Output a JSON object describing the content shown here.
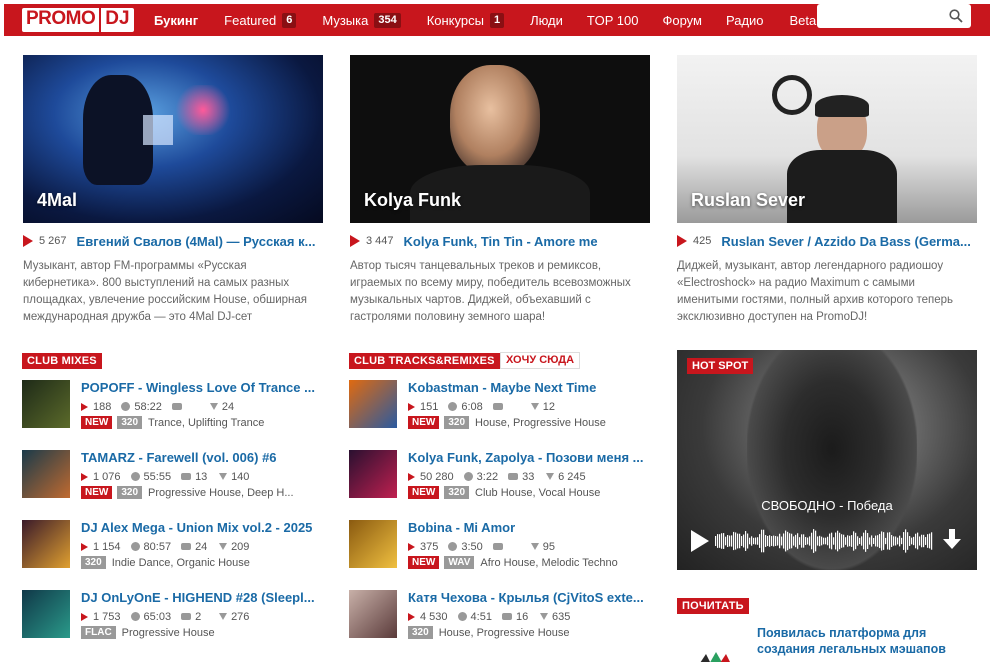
{
  "header": {
    "logo_left": "PROMO",
    "logo_right": "DJ",
    "nav": [
      {
        "label": "Букинг",
        "badge": null,
        "bold": true
      },
      {
        "label": "Featured",
        "badge": "6",
        "bold": false
      },
      {
        "label": "Музыка",
        "badge": "354",
        "bold": false
      },
      {
        "label": "Конкурсы",
        "badge": "1",
        "bold": false
      },
      {
        "label": "Люди",
        "badge": null,
        "bold": false
      },
      {
        "label": "TOP 100",
        "badge": null,
        "bold": false
      },
      {
        "label": "Форум",
        "badge": null,
        "bold": false
      },
      {
        "label": "Радио",
        "badge": null,
        "bold": false
      },
      {
        "label": "Beta",
        "badge": null,
        "bold": false
      }
    ],
    "search_placeholder": ""
  },
  "features": [
    {
      "name": "4Mal",
      "plays": "5 267",
      "title": "Евгений Свалов (4Mal) — Русская к...",
      "desc": "Музыкант, автор FM-программы «Русская кибернетика». 800 выступлений на самых разных площадках, увлечение российским House, обширная международная дружба — это 4Mal DJ-сет"
    },
    {
      "name": "Kolya Funk",
      "plays": "3 447",
      "title": "Kolya Funk, Tin Tin - Amore me",
      "desc": "Автор тысяч танцевальных треков и ремиксов, играемых по всему миру, победитель всевозможных музыкальных чартов. Диджей, объехавший с гастролями половину земного шара!"
    },
    {
      "name": "Ruslan Sever",
      "plays": "425",
      "title": "Ruslan Sever / Azzido Da Bass (Germa...",
      "desc": "Диджей, музыкант, автор легендарного радиошоу «Electroshock» на радио Maximum с самыми именитыми гостями, полный архив которого теперь эксклюзивно доступен на PromoDJ!"
    }
  ],
  "sections": {
    "club_mixes": "CLUB MIXES",
    "club_tracks": "CLUB TRACKS&REMIXES",
    "want_here": "ХОЧУ СЮДА",
    "hot_spot": "HOT SPOT",
    "read": "ПОЧИТАТЬ"
  },
  "mixes": [
    {
      "title": "POPOFF - Wingless Love Of Trance ...",
      "plays": "188",
      "duration": "58:22",
      "comments": "",
      "downloads": "24",
      "new": "NEW",
      "format": "320",
      "genre": "Trance, Uplifting Trance",
      "cover": [
        "#1e2a18",
        "#5b6a2a"
      ]
    },
    {
      "title": "TAMARZ - Farewell (vol. 006) #6",
      "plays": "1 076",
      "duration": "55:55",
      "comments": "13",
      "downloads": "140",
      "new": "NEW",
      "format": "320",
      "genre": "Progressive House, Deep H...",
      "cover": [
        "#1a3a4a",
        "#c06a30"
      ]
    },
    {
      "title": "DJ Alex Mega - Union Mix vol.2 - 2025",
      "plays": "1 154",
      "duration": "80:57",
      "comments": "24",
      "downloads": "209",
      "new": "",
      "format": "320",
      "genre": "Indie Dance, Organic House",
      "cover": [
        "#3a1a2a",
        "#e0a030"
      ]
    },
    {
      "title": "DJ OnLyOnE - HIGHEND #28 (Sleepl...",
      "plays": "1 753",
      "duration": "65:03",
      "comments": "2",
      "downloads": "276",
      "new": "",
      "format": "FLAC",
      "genre": "Progressive House",
      "cover": [
        "#103848",
        "#2a9a8a"
      ]
    }
  ],
  "tracks": [
    {
      "title": "Kobastman - Maybe Next Time",
      "plays": "151",
      "duration": "6:08",
      "comments": "",
      "downloads": "12",
      "new": "NEW",
      "format": "320",
      "genre": "House, Progressive House",
      "cover": [
        "#e06a10",
        "#2a5aa0"
      ]
    },
    {
      "title": "Kolya Funk, Zapolya - Позови меня ...",
      "plays": "50 280",
      "duration": "3:22",
      "comments": "33",
      "downloads": "6 245",
      "new": "NEW",
      "format": "320",
      "genre": "Club House, Vocal House",
      "cover": [
        "#2a1030",
        "#c02050"
      ]
    },
    {
      "title": "Bobina - Mi Amor",
      "plays": "375",
      "duration": "3:50",
      "comments": "",
      "downloads": "95",
      "new": "NEW",
      "format": "WAV",
      "genre": "Afro House, Melodic Techno",
      "cover": [
        "#8a5a10",
        "#f0c040"
      ]
    },
    {
      "title": "Катя Чехова - Крылья (CjVitoS exte...",
      "plays": "4 530",
      "duration": "4:51",
      "comments": "16",
      "downloads": "635",
      "new": "",
      "format": "320",
      "genre": "House, Progressive House",
      "cover": [
        "#c8b0a8",
        "#5a3a3a"
      ]
    }
  ],
  "hotspot": {
    "title": "СВОБОДНО - Победа"
  },
  "news": {
    "title": "Появилась платформа для создания легальных мэшапов"
  },
  "colors": {
    "brand": "#c8161d",
    "link": "#1a6aa6"
  }
}
